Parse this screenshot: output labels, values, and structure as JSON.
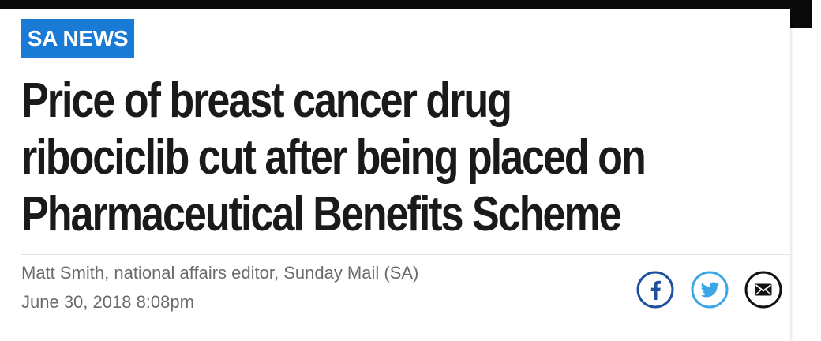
{
  "section_badge": "SA NEWS",
  "headline": {
    "line1": "Price of breast cancer drug",
    "line2": "ribociclib cut after being placed on",
    "line3": "Pharmaceutical Benefits Scheme"
  },
  "byline": "Matt Smith, national affairs editor, Sunday Mail (SA)",
  "date": "June 30, 2018 8:08pm",
  "share": {
    "facebook_icon": "facebook-icon",
    "twitter_icon": "twitter-icon",
    "email_icon": "email-icon"
  },
  "colors": {
    "badge_background": "#1a7bd6",
    "badge_text": "#ffffff",
    "headline_text": "#1a1a1a",
    "meta_text": "#6b6b6b",
    "facebook": "#1d4f9c",
    "twitter": "#3aa6e6",
    "email": "#111111"
  }
}
